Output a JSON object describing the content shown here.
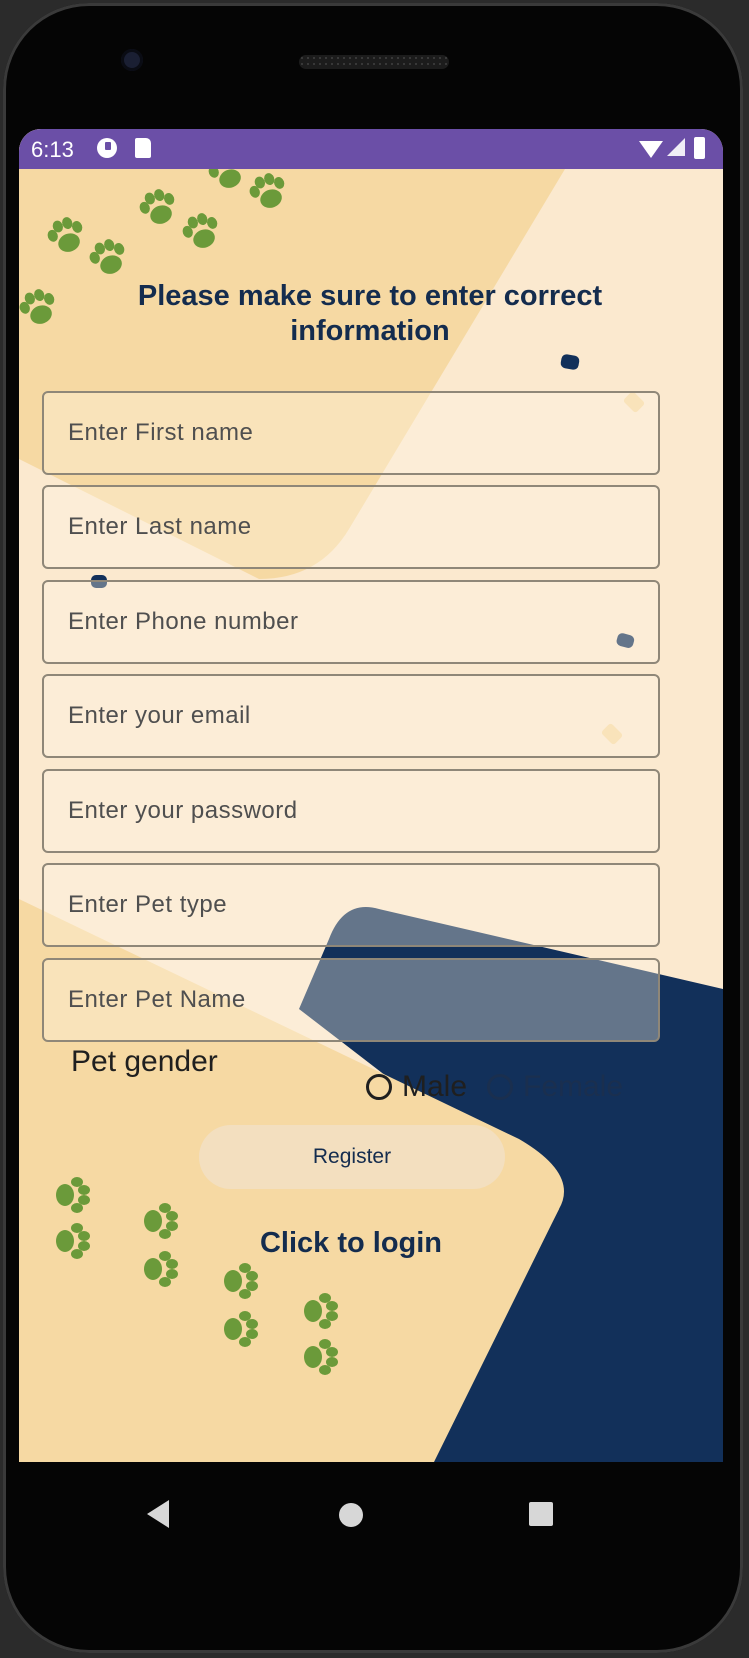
{
  "status_bar": {
    "time": "6:13",
    "icons": [
      "app-notification-icon",
      "sd-card-icon",
      "wifi-icon",
      "cell-signal-icon",
      "battery-icon"
    ],
    "background": "#6b4fa7"
  },
  "form": {
    "heading": "Please make sure to enter correct information",
    "fields": [
      {
        "placeholder": "Enter First name"
      },
      {
        "placeholder": "Enter Last name"
      },
      {
        "placeholder": "Enter Phone number"
      },
      {
        "placeholder": "Enter your email"
      },
      {
        "placeholder": "Enter your password"
      },
      {
        "placeholder": "Enter Pet type"
      },
      {
        "placeholder": "Enter Pet Name"
      }
    ],
    "gender": {
      "label": "Pet gender",
      "options": [
        "Male",
        "Female"
      ]
    },
    "register_label": "Register",
    "login_link": "Click to login"
  },
  "nav_bar": {
    "icons": [
      "back-icon",
      "home-icon",
      "recents-icon"
    ]
  },
  "colors": {
    "primary_text": "#142c4e",
    "cream_bg": "#fbe9cf",
    "sand": "#f6d9a3",
    "navy": "#12305a",
    "paw_green": "#6b9a3a"
  }
}
